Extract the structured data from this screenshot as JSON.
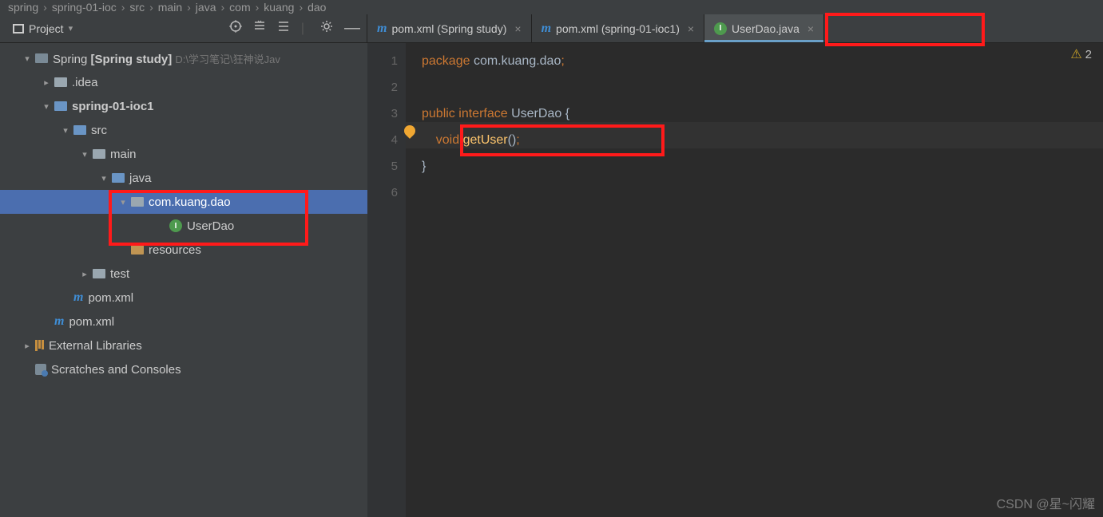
{
  "breadcrumb": [
    "spring",
    "spring-01-ioc",
    "src",
    "main",
    "java",
    "com",
    "kuang",
    "dao"
  ],
  "project_panel": {
    "title": "Project"
  },
  "tabs": [
    {
      "icon": "m",
      "label": "pom.xml (Spring study)",
      "active": false
    },
    {
      "icon": "m",
      "label": "pom.xml (spring-01-ioc1)",
      "active": false
    },
    {
      "icon": "i",
      "label": "UserDao.java",
      "active": true
    }
  ],
  "tree": [
    {
      "indent": 28,
      "chev": "open",
      "icon": "proj",
      "label_html": "Spring <b>[Spring study]</b> <span class=dim>D:\\学习笔记\\狂神说Jav</span>"
    },
    {
      "indent": 52,
      "chev": "closed",
      "icon": "folder",
      "label": ".idea"
    },
    {
      "indent": 52,
      "chev": "open",
      "icon": "mod",
      "label_html": "<b>spring-01-ioc1</b>"
    },
    {
      "indent": 76,
      "chev": "open",
      "icon": "src",
      "label": "src"
    },
    {
      "indent": 100,
      "chev": "open",
      "icon": "folder",
      "label": "main"
    },
    {
      "indent": 124,
      "chev": "open",
      "icon": "src",
      "label": "java"
    },
    {
      "indent": 148,
      "chev": "open",
      "icon": "pkg",
      "label": "com.kuang.dao",
      "selected": true
    },
    {
      "indent": 196,
      "chev": "none",
      "icon": "interface",
      "label": "UserDao"
    },
    {
      "indent": 148,
      "chev": "none",
      "icon": "res",
      "label": "resources"
    },
    {
      "indent": 100,
      "chev": "closed",
      "icon": "folder",
      "label": "test"
    },
    {
      "indent": 76,
      "chev": "none",
      "icon": "m",
      "label": "pom.xml"
    },
    {
      "indent": 52,
      "chev": "none",
      "icon": "m",
      "label": "pom.xml"
    },
    {
      "indent": 28,
      "chev": "closed",
      "icon": "lib",
      "label": "External Libraries"
    },
    {
      "indent": 28,
      "chev": "none",
      "icon": "scratch",
      "label": "Scratches and Consoles"
    }
  ],
  "editor": {
    "lines": [
      "1",
      "2",
      "3",
      "4",
      "5",
      "6"
    ],
    "code": {
      "l1": {
        "kw": "package",
        "pkg": " com.kuang.dao",
        "semi": ";"
      },
      "l3": {
        "kw1": "public",
        "kw2": "interface",
        "cls": "UserDao",
        "brace": "{"
      },
      "l4": {
        "kw": "void",
        "method": "getUser",
        "paren": "()",
        "semi": ";"
      },
      "l5": {
        "brace": "}"
      }
    },
    "warning_count": "2"
  },
  "watermark": "CSDN @星~闪耀"
}
